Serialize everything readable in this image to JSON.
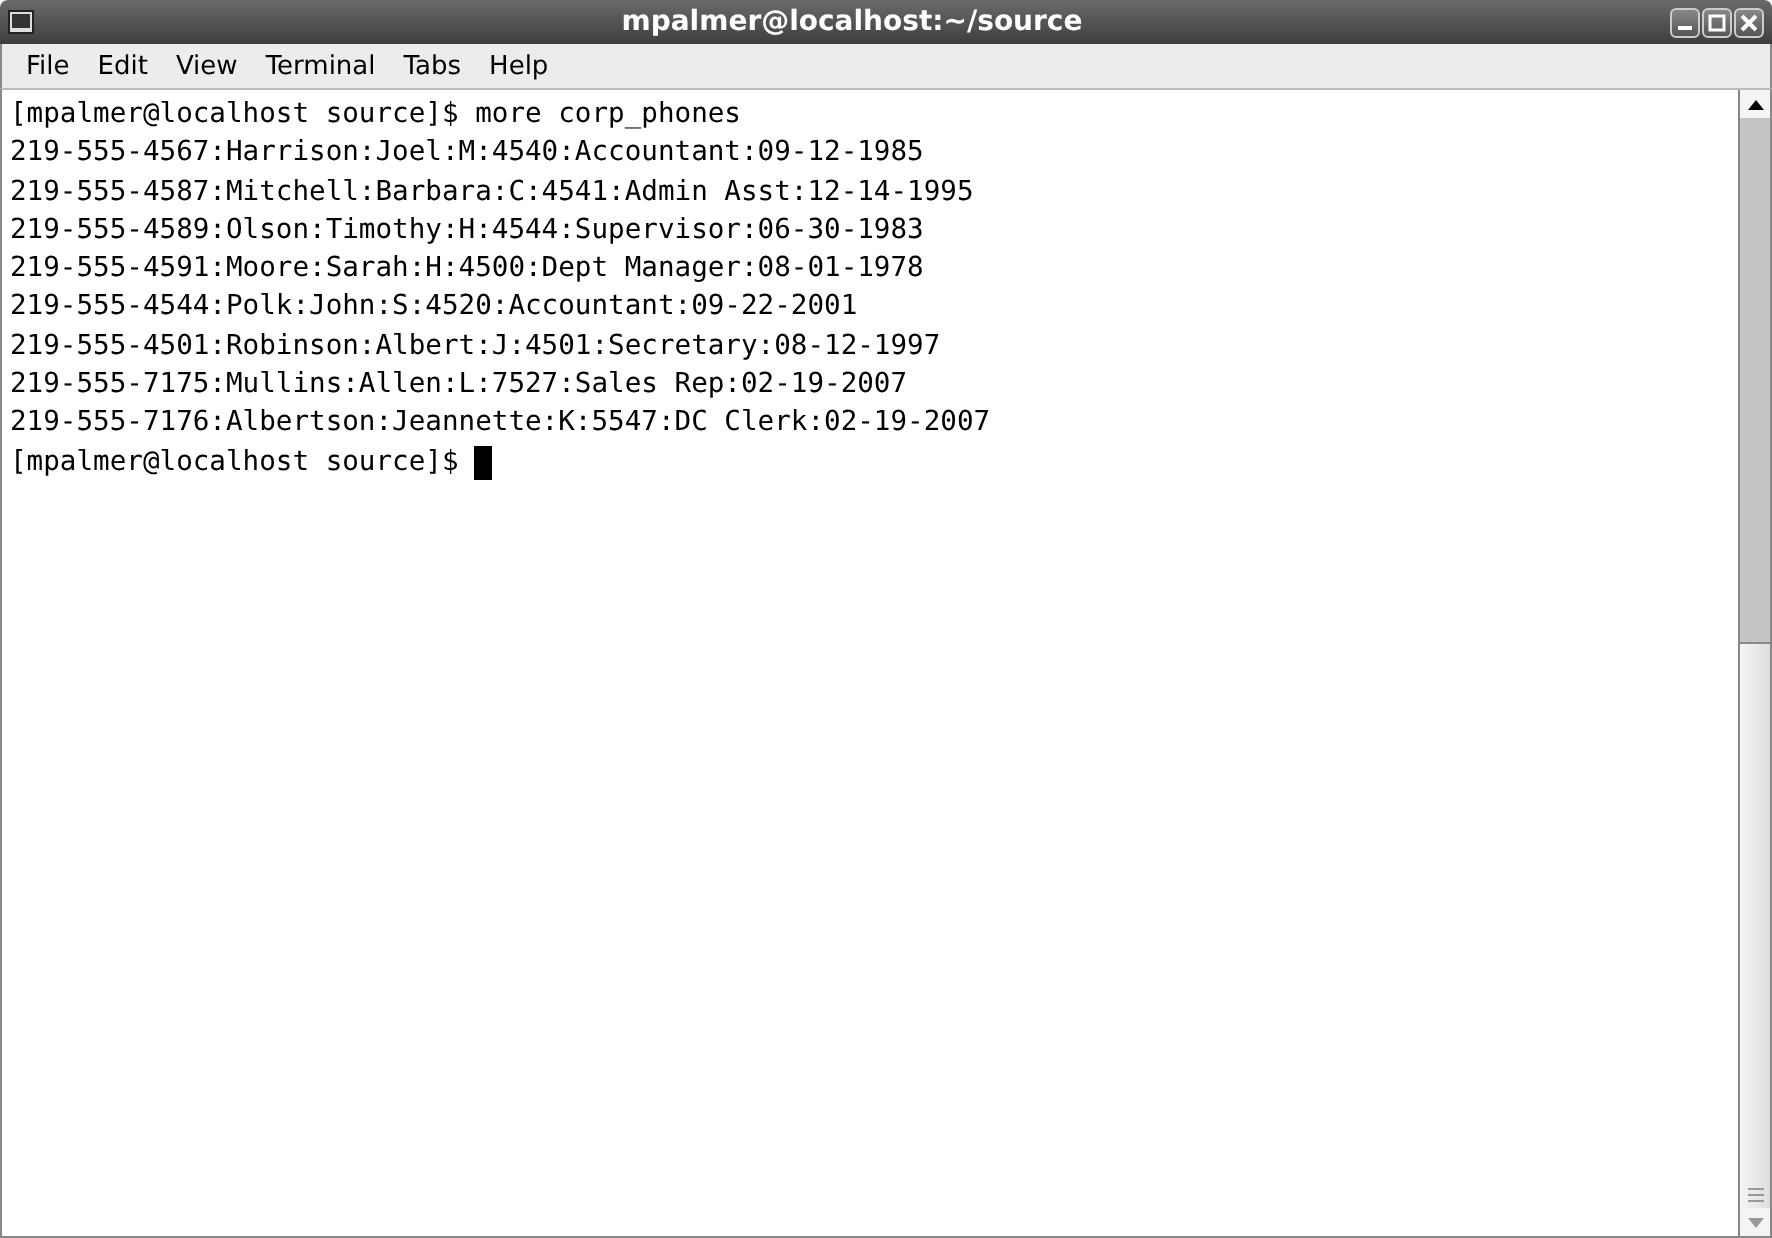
{
  "window": {
    "title": "mpalmer@localhost:~/source"
  },
  "menu": [
    {
      "label": "File"
    },
    {
      "label": "Edit"
    },
    {
      "label": "View"
    },
    {
      "label": "Terminal"
    },
    {
      "label": "Tabs"
    },
    {
      "label": "Help"
    }
  ],
  "terminal": {
    "lines": [
      "[mpalmer@localhost source]$ more corp_phones",
      "219-555-4567:Harrison:Joel:M:4540:Accountant:09-12-1985",
      "219-555-4587:Mitchell:Barbara:C:4541:Admin Asst:12-14-1995",
      "219-555-4589:Olson:Timothy:H:4544:Supervisor:06-30-1983",
      "219-555-4591:Moore:Sarah:H:4500:Dept Manager:08-01-1978",
      "219-555-4544:Polk:John:S:4520:Accountant:09-22-2001",
      "219-555-4501:Robinson:Albert:J:4501:Secretary:08-12-1997",
      "219-555-7175:Mullins:Allen:L:7527:Sales Rep:02-19-2007",
      "219-555-7176:Albertson:Jeannette:K:5547:DC Clerk:02-19-2007"
    ],
    "prompt": "[mpalmer@localhost source]$"
  }
}
